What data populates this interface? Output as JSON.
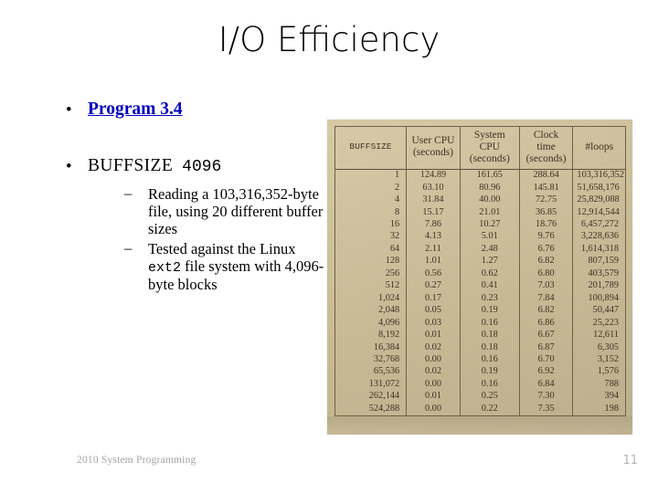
{
  "slide": {
    "title": "I/O Efficiency",
    "page_number": "11",
    "footer_note": "2010 System Programming",
    "background_color": "#ffffff",
    "link_color": "#0000c0",
    "scan_background_color": "#d3c39d"
  },
  "bullets": {
    "link_label": "Program 3.4",
    "buffsize_keyword": "BUFFSIZE",
    "buffsize_value": "4096",
    "sub_items": [
      {
        "parts": [
          {
            "text": "Reading a 103,316,352-byte file, using 20 different buffer sizes",
            "style": "normal"
          }
        ]
      },
      {
        "parts": [
          {
            "text": "Tested against the Linux ",
            "style": "normal"
          },
          {
            "text": "ext2",
            "style": "mono"
          },
          {
            "text": " file system with 4,096-byte blocks",
            "style": "normal"
          }
        ]
      }
    ],
    "sub_item_1_text": "Reading a 103,316,352-byte file, using 20 different buffer sizes",
    "sub_item_2_pre": "Tested against the Linux ",
    "sub_item_2_mono": "ext2",
    "sub_item_2_post": " file system with 4,096-byte blocks",
    "bullet_glyph": "•",
    "dash_glyph": "–"
  },
  "chart_data": {
    "type": "table",
    "title": "I/O efficiency measurements by buffer size",
    "columns": [
      "BUFFSIZE",
      "User CPU\n(seconds)",
      "System CPU\n(seconds)",
      "Clock time\n(seconds)",
      "#loops"
    ],
    "column_headers": [
      {
        "line1": "BUFFSIZE",
        "line2": ""
      },
      {
        "line1": "User CPU",
        "line2": "(seconds)"
      },
      {
        "line1": "System CPU",
        "line2": "(seconds)"
      },
      {
        "line1": "Clock time",
        "line2": "(seconds)"
      },
      {
        "line1": "#loops",
        "line2": ""
      }
    ],
    "categories": [
      "1",
      "2",
      "4",
      "8",
      "16",
      "32",
      "64",
      "128",
      "256",
      "512",
      "1,024",
      "2,048",
      "4,096",
      "8,192",
      "16,384",
      "32,768",
      "65,536",
      "131,072",
      "262,144",
      "524,288"
    ],
    "series": [
      {
        "name": "User CPU (seconds)",
        "values": [
          124.89,
          63.1,
          31.84,
          15.17,
          7.86,
          4.13,
          2.11,
          1.01,
          0.56,
          0.27,
          0.17,
          0.05,
          0.03,
          0.01,
          0.02,
          0.0,
          0.02,
          0.0,
          0.01,
          0.0
        ]
      },
      {
        "name": "System CPU (seconds)",
        "values": [
          161.65,
          80.96,
          40.0,
          21.01,
          10.27,
          5.01,
          2.48,
          1.27,
          0.62,
          0.41,
          0.23,
          0.19,
          0.16,
          0.18,
          0.18,
          0.16,
          0.19,
          0.16,
          0.25,
          0.22
        ]
      },
      {
        "name": "Clock time (seconds)",
        "values": [
          288.64,
          145.81,
          72.75,
          36.85,
          18.76,
          9.76,
          6.76,
          6.82,
          6.8,
          7.03,
          7.84,
          6.82,
          6.86,
          6.67,
          6.87,
          6.7,
          6.92,
          6.84,
          7.3,
          7.35
        ]
      },
      {
        "name": "#loops",
        "values": [
          103316352,
          51658176,
          25829088,
          12914544,
          6457272,
          3228636,
          1614318,
          807159,
          403579,
          201789,
          100894,
          50447,
          25223,
          12611,
          6305,
          3152,
          1576,
          788,
          394,
          198
        ]
      }
    ],
    "rows": [
      {
        "buffsize": "1",
        "user_cpu": "124.89",
        "system_cpu": "161.65",
        "clock_time": "288.64",
        "loops": "103,316,352"
      },
      {
        "buffsize": "2",
        "user_cpu": "63.10",
        "system_cpu": "80.96",
        "clock_time": "145.81",
        "loops": "51,658,176"
      },
      {
        "buffsize": "4",
        "user_cpu": "31.84",
        "system_cpu": "40.00",
        "clock_time": "72.75",
        "loops": "25,829,088"
      },
      {
        "buffsize": "8",
        "user_cpu": "15.17",
        "system_cpu": "21.01",
        "clock_time": "36.85",
        "loops": "12,914,544"
      },
      {
        "buffsize": "16",
        "user_cpu": "7.86",
        "system_cpu": "10.27",
        "clock_time": "18.76",
        "loops": "6,457,272"
      },
      {
        "buffsize": "32",
        "user_cpu": "4.13",
        "system_cpu": "5.01",
        "clock_time": "9.76",
        "loops": "3,228,636"
      },
      {
        "buffsize": "64",
        "user_cpu": "2.11",
        "system_cpu": "2.48",
        "clock_time": "6.76",
        "loops": "1,614,318"
      },
      {
        "buffsize": "128",
        "user_cpu": "1.01",
        "system_cpu": "1.27",
        "clock_time": "6.82",
        "loops": "807,159"
      },
      {
        "buffsize": "256",
        "user_cpu": "0.56",
        "system_cpu": "0.62",
        "clock_time": "6.80",
        "loops": "403,579"
      },
      {
        "buffsize": "512",
        "user_cpu": "0.27",
        "system_cpu": "0.41",
        "clock_time": "7.03",
        "loops": "201,789"
      },
      {
        "buffsize": "1,024",
        "user_cpu": "0.17",
        "system_cpu": "0.23",
        "clock_time": "7.84",
        "loops": "100,894"
      },
      {
        "buffsize": "2,048",
        "user_cpu": "0.05",
        "system_cpu": "0.19",
        "clock_time": "6.82",
        "loops": "50,447"
      },
      {
        "buffsize": "4,096",
        "user_cpu": "0.03",
        "system_cpu": "0.16",
        "clock_time": "6.86",
        "loops": "25,223"
      },
      {
        "buffsize": "8,192",
        "user_cpu": "0.01",
        "system_cpu": "0.18",
        "clock_time": "6.67",
        "loops": "12,611"
      },
      {
        "buffsize": "16,384",
        "user_cpu": "0.02",
        "system_cpu": "0.18",
        "clock_time": "6.87",
        "loops": "6,305"
      },
      {
        "buffsize": "32,768",
        "user_cpu": "0.00",
        "system_cpu": "0.16",
        "clock_time": "6.70",
        "loops": "3,152"
      },
      {
        "buffsize": "65,536",
        "user_cpu": "0.02",
        "system_cpu": "0.19",
        "clock_time": "6.92",
        "loops": "1,576"
      },
      {
        "buffsize": "131,072",
        "user_cpu": "0.00",
        "system_cpu": "0.16",
        "clock_time": "6.84",
        "loops": "788"
      },
      {
        "buffsize": "262,144",
        "user_cpu": "0.01",
        "system_cpu": "0.25",
        "clock_time": "7.30",
        "loops": "394"
      },
      {
        "buffsize": "524,288",
        "user_cpu": "0.00",
        "system_cpu": "0.22",
        "clock_time": "7.35",
        "loops": "198"
      }
    ],
    "grid": true,
    "legend": "none"
  }
}
